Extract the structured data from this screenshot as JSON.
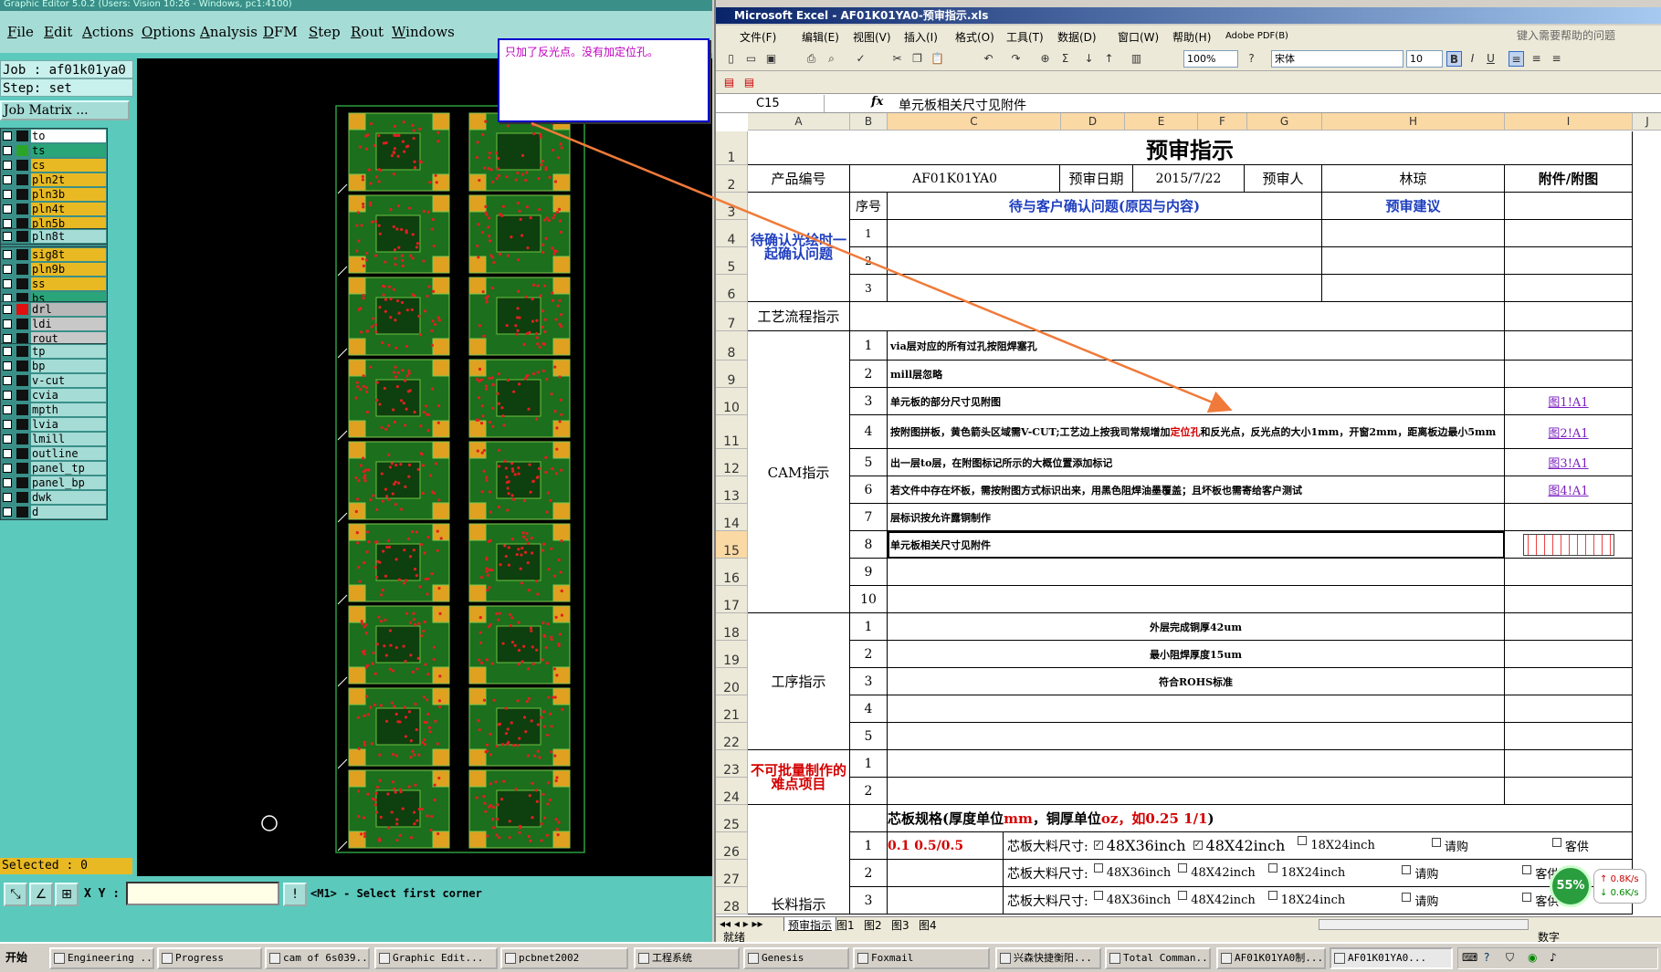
{
  "cam": {
    "title": "Graphic Editor 5.0.2 (Users: Vision 10:26 - Windows, pc1:4100)",
    "menu": [
      "File",
      "Edit",
      "Actions",
      "Options",
      "Analysis",
      "DFM",
      "Step",
      "Rout",
      "Windows"
    ],
    "job": "Job : af01k01ya0",
    "step": "Step: set",
    "job_matrix": "Job Matrix ...",
    "layer_groups": [
      [
        {
          "name": "to",
          "swatch": "#111111",
          "bg": "#ffffff"
        },
        {
          "name": "ts",
          "swatch": "#2aa52a",
          "bg": "#2aa57a"
        },
        {
          "name": "cs",
          "swatch": "#111111",
          "bg": "#e8b923"
        },
        {
          "name": "pln2t",
          "swatch": "#111111",
          "bg": "#e8b923"
        },
        {
          "name": "pln3b",
          "swatch": "#111111",
          "bg": "#e8b923"
        },
        {
          "name": "pln4t",
          "swatch": "#111111",
          "bg": "#e8b923"
        },
        {
          "name": "pln5b",
          "swatch": "#111111",
          "bg": "#e8b923"
        },
        {
          "name": "pln6t",
          "swatch": "#111111",
          "bg": "#e8b923"
        },
        {
          "name": "pln7b",
          "swatch": "#111111",
          "bg": "#e8b923"
        }
      ],
      [
        {
          "name": "pln8t",
          "swatch": "#111111",
          "bg": "#a6dcd6"
        }
      ],
      [
        {
          "name": "sig8t",
          "swatch": "#111111",
          "bg": "#e8b923"
        },
        {
          "name": "pln9b",
          "swatch": "#111111",
          "bg": "#e8b923"
        },
        {
          "name": "ss",
          "swatch": "#111111",
          "bg": "#e8b923"
        },
        {
          "name": "bs",
          "swatch": "#111111",
          "bg": "#2aa57a"
        }
      ],
      [
        {
          "name": "drl",
          "swatch": "#e01010",
          "bg": "#b8b8b8"
        },
        {
          "name": "ldi",
          "swatch": "#111111",
          "bg": "#c8c8c8"
        },
        {
          "name": "rout",
          "swatch": "#111111",
          "bg": "#c8c8c8"
        }
      ],
      [
        {
          "name": "tp",
          "swatch": "#111111",
          "bg": "#a6dcd6"
        },
        {
          "name": "bp",
          "swatch": "#111111",
          "bg": "#a6dcd6"
        },
        {
          "name": "v-cut",
          "swatch": "#111111",
          "bg": "#a6dcd6"
        },
        {
          "name": "cvia",
          "swatch": "#111111",
          "bg": "#a6dcd6"
        },
        {
          "name": "mpth",
          "swatch": "#111111",
          "bg": "#a6dcd6"
        },
        {
          "name": "lvia",
          "swatch": "#111111",
          "bg": "#a6dcd6"
        },
        {
          "name": "lmill",
          "swatch": "#111111",
          "bg": "#a6dcd6"
        },
        {
          "name": "outline",
          "swatch": "#111111",
          "bg": "#a6dcd6"
        },
        {
          "name": "panel_tp",
          "swatch": "#111111",
          "bg": "#a6dcd6"
        },
        {
          "name": "panel_bp",
          "swatch": "#111111",
          "bg": "#a6dcd6"
        },
        {
          "name": "dwk",
          "swatch": "#111111",
          "bg": "#a6dcd6"
        },
        {
          "name": "d",
          "swatch": "#111111",
          "bg": "#a6dcd6"
        }
      ]
    ],
    "selected": "Selected : 0",
    "xy_label": "X Y :",
    "xy_value": "",
    "status": "<M1> - Select first corner"
  },
  "note": {
    "text": "只加了反光点。没有加定位孔。"
  },
  "excel": {
    "title": "Microsoft Excel - AF01K01YA0-预审指示.xls",
    "menu": [
      "文件(F)",
      "编辑(E)",
      "视图(V)",
      "插入(I)",
      "格式(O)",
      "工具(T)",
      "数据(D)",
      "窗口(W)",
      "帮助(H)",
      "Adobe PDF(B)"
    ],
    "help_placeholder": "键入需要帮助的问题",
    "zoom": "100%",
    "font": "宋体",
    "font_size": "10",
    "name_box": "C15",
    "formula": "单元板相关尺寸见附件",
    "columns": [
      "A",
      "B",
      "C",
      "D",
      "E",
      "F",
      "G",
      "H",
      "I",
      "J"
    ],
    "rows": [
      "1",
      "2",
      "3",
      "4",
      "5",
      "6",
      "7",
      "8",
      "9",
      "10",
      "11",
      "12",
      "13",
      "14",
      "15",
      "16",
      "17",
      "18",
      "19",
      "20",
      "21",
      "22",
      "23",
      "24",
      "25",
      "26",
      "27",
      "28"
    ],
    "sheet": {
      "title": "预审指示",
      "product_label": "产品编号",
      "product_no": "AF01K01YA0",
      "date_label": "预审日期",
      "date": "2015/7/22",
      "reviewer_label": "预审人",
      "reviewer": "林琼",
      "attach_label": "附件/附图",
      "confirm_section": "待确认光绘时一起确认问题",
      "seq_label": "序号",
      "confirm_header": "待与客户确认问题(原因与内容)",
      "suggest_header": "预审建议",
      "confirm_nums": [
        "1",
        "2",
        "3"
      ],
      "process_section": "工艺流程指示",
      "cam_section": "CAM指示",
      "cam_nums": [
        "1",
        "2",
        "3",
        "4",
        "5",
        "6",
        "7",
        "8",
        "9",
        "10"
      ],
      "cam_items": [
        "via层对应的所有过孔按阻焊塞孔",
        "mill层忽略",
        "单元板的部分尺寸见附图",
        "",
        "出一层to层，在附图标记所示的大概位置添加标记",
        "若文件中存在坏板，需按附图方式标识出来，用黑色阻焊油墨覆盖；且坏板也需寄给客户测试",
        "层标识按允许露铜制作",
        "单元板相关尺寸见附件",
        "",
        ""
      ],
      "cam_item4_pre": "按附图拼板，黄色箭头区域需V-CUT;工艺边上按我司常规增加",
      "cam_item4_red": "定位孔",
      "cam_item4_post": "和反光点，反光点的大小1mm，开窗2mm，距离板边最小5mm",
      "cam_links": [
        "",
        "",
        "图1!A1",
        "图2!A1",
        "图3!A1",
        "图4!A1",
        "",
        "",
        "",
        ""
      ],
      "op_section": "工序指示",
      "op_nums": [
        "1",
        "2",
        "3",
        "4",
        "5"
      ],
      "op_items": [
        "外层完成铜厚42um",
        "最小阻焊厚度15um",
        "符合ROHS标准",
        "",
        ""
      ],
      "hard_section": "不可批量制作的难点项目",
      "hard_nums": [
        "1",
        "2"
      ],
      "core_spec_pre": "芯板规格(厚度单位",
      "core_spec_mm": "mm",
      "core_spec_mid": "，铜厚单位",
      "core_spec_oz": "oz，如0.25 1/1",
      "core_spec_end": ")",
      "core_rows": [
        {
          "num": "1",
          "value": "0.1 0.5/0.5",
          "label": "芯板大料尺寸:",
          "a": "48X36inch",
          "a_checked": true,
          "b": "48X42inch",
          "b_checked": true,
          "c": "18X24inch",
          "d": "请购",
          "e": "客供"
        },
        {
          "num": "2",
          "value": "",
          "label": "芯板大料尺寸:",
          "a": "48X36inch",
          "a_checked": false,
          "b": "48X42inch",
          "b_checked": false,
          "c": "18X24inch",
          "d": "请购",
          "e": "客供"
        },
        {
          "num": "3",
          "value": "",
          "label": "芯板大料尺寸:",
          "a": "48X36inch",
          "a_checked": false,
          "b": "48X42inch",
          "b_checked": false,
          "c": "18X24inch",
          "d": "请购",
          "e": "客供"
        }
      ],
      "partial_label": "长料指示"
    },
    "tabs": [
      "预审指示",
      "图1",
      "图2",
      "图3",
      "图4"
    ],
    "status_left": "就绪",
    "status_right": "数字"
  },
  "net_widget": {
    "percent": "55%",
    "up": "0.8K/s",
    "down": "0.6K/s"
  },
  "taskbar": {
    "start": "开始",
    "tasks": [
      "Engineering ...",
      "Progress",
      "cam of 6s039...",
      "Graphic Edit...",
      "pcbnet2002",
      "工程系统",
      "Genesis",
      "Foxmail",
      "兴森快捷衡阳...",
      "Total Comman...",
      "AF01K01YA0制...",
      "AF01K01YA0..."
    ]
  }
}
